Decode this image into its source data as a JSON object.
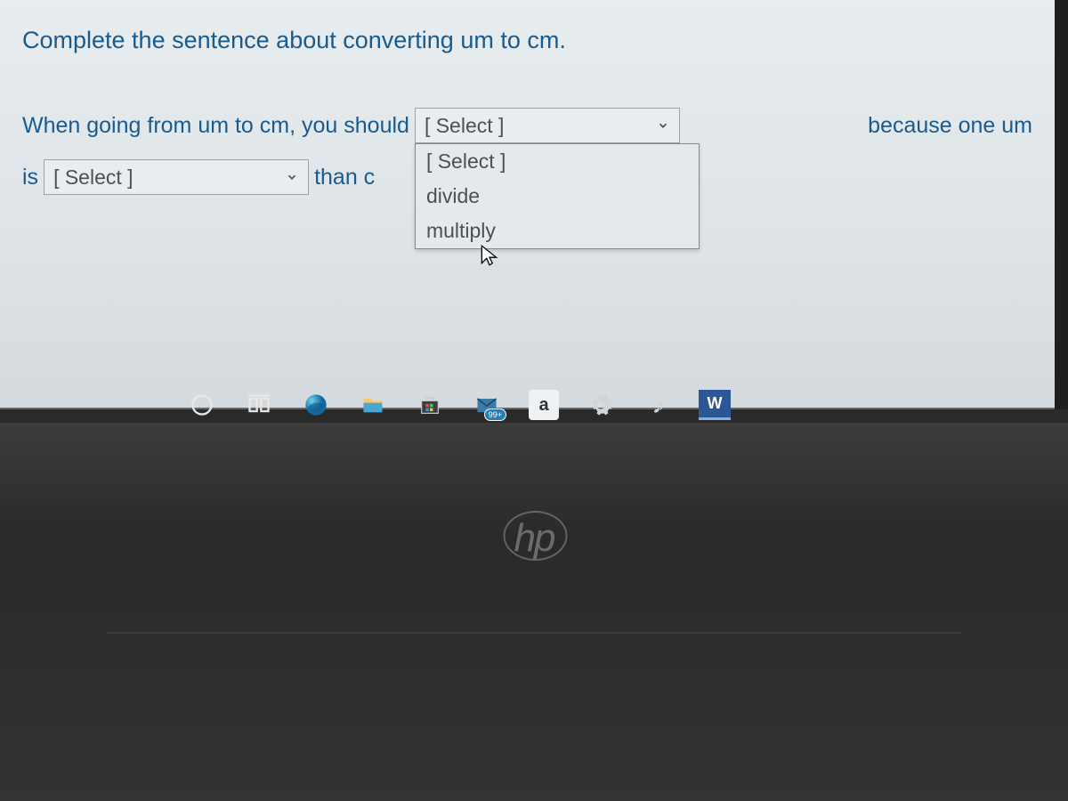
{
  "question": {
    "prompt": "Complete the sentence about converting um to cm.",
    "line1_prefix": "When going from um to cm, you should",
    "line1_suffix": "because one um",
    "line2_prefix": "is",
    "line2_mid": "than c"
  },
  "select1": {
    "selected": "[ Select ]",
    "options": [
      "[ Select ]",
      "divide",
      "multiply"
    ]
  },
  "select2": {
    "selected": "[ Select ]"
  },
  "taskbar": {
    "mail_badge": "99+",
    "letter_app": "a",
    "word_label": "W"
  },
  "laptop_brand": "hp"
}
